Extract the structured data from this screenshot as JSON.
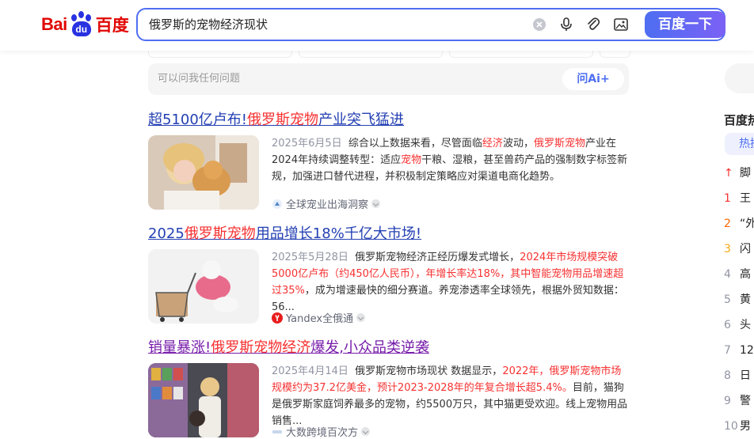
{
  "header": {
    "logo_left": "Bai",
    "logo_paw": "du",
    "logo_right": "百度",
    "query": "俄罗斯的宠物经济现状",
    "search_button": "百度一下",
    "icons": [
      "clear-icon",
      "microphone-icon",
      "attachment-icon",
      "image-search-icon"
    ]
  },
  "ai": {
    "placeholder": "可以问我任何问题",
    "button": "问Ai+"
  },
  "results": [
    {
      "title_parts": [
        "超5100亿卢布!",
        "俄罗斯宠物",
        "产业突飞猛进"
      ],
      "date": "2025年6月5日",
      "snippet": [
        "综合以上数据来看，尽管面临",
        "经济",
        "波动，",
        "俄罗斯宠物",
        "产业在2024年持续调整转型：适应",
        "宠物",
        "干粮、湿粮，甚至兽药产品的强制数字标签新规，加强进口替代进程，并积极制定策略应对渠道电商化趋势。"
      ],
      "source": "全球宠业出海洞察"
    },
    {
      "title_parts": [
        "2025",
        "俄罗斯宠物",
        "用品增长18%千亿大市场!"
      ],
      "date": "2025年5月28日",
      "snippet": [
        "俄罗斯宠物经济正经历爆发式增长，",
        "2024年市场规模突破5000亿卢布（约450亿人民币），年增长率达18%，其中智能宠物用品增速超过35%",
        "，成为增速最快的细分赛道。养宠渗透率全球领先，根据外贸知数据：56..."
      ],
      "source": "Yandex全俄通"
    },
    {
      "title_parts": [
        "销量暴涨!",
        "俄罗斯宠物经济",
        "爆发,小众品类逆袭"
      ],
      "date": "2025年4月14日",
      "snippet": [
        "俄罗斯宠物市场现状 数据显示，",
        "2022年，俄罗斯宠物市场规模约为37.2亿美金，预计2023-2028年的年复合增长超5.4%。",
        "目前，猫狗是俄罗斯家庭饲养最多的宠物，约5500万只，其中猫更受欢迎。线上宠物用品销售..."
      ],
      "source": "大数跨境百次方"
    }
  ],
  "sidebar": {
    "hot_title": "百度热搜",
    "hot_tab": "热搜",
    "items": [
      {
        "n": "↑",
        "t": "脚"
      },
      {
        "n": "1",
        "t": "王"
      },
      {
        "n": "2",
        "t": "“外"
      },
      {
        "n": "3",
        "t": "闪"
      },
      {
        "n": "4",
        "t": "高"
      },
      {
        "n": "5",
        "t": "黄"
      },
      {
        "n": "6",
        "t": "头"
      },
      {
        "n": "7",
        "t": "12"
      },
      {
        "n": "8",
        "t": "日"
      },
      {
        "n": "9",
        "t": "警"
      },
      {
        "n": "10",
        "t": "男"
      }
    ]
  },
  "colors": {
    "accent": "#4e6ef2",
    "link": "#2440b3",
    "visited": "#771caa",
    "highlight": "#f73131",
    "logo_red": "#e10602",
    "logo_blue": "#2932e1"
  }
}
